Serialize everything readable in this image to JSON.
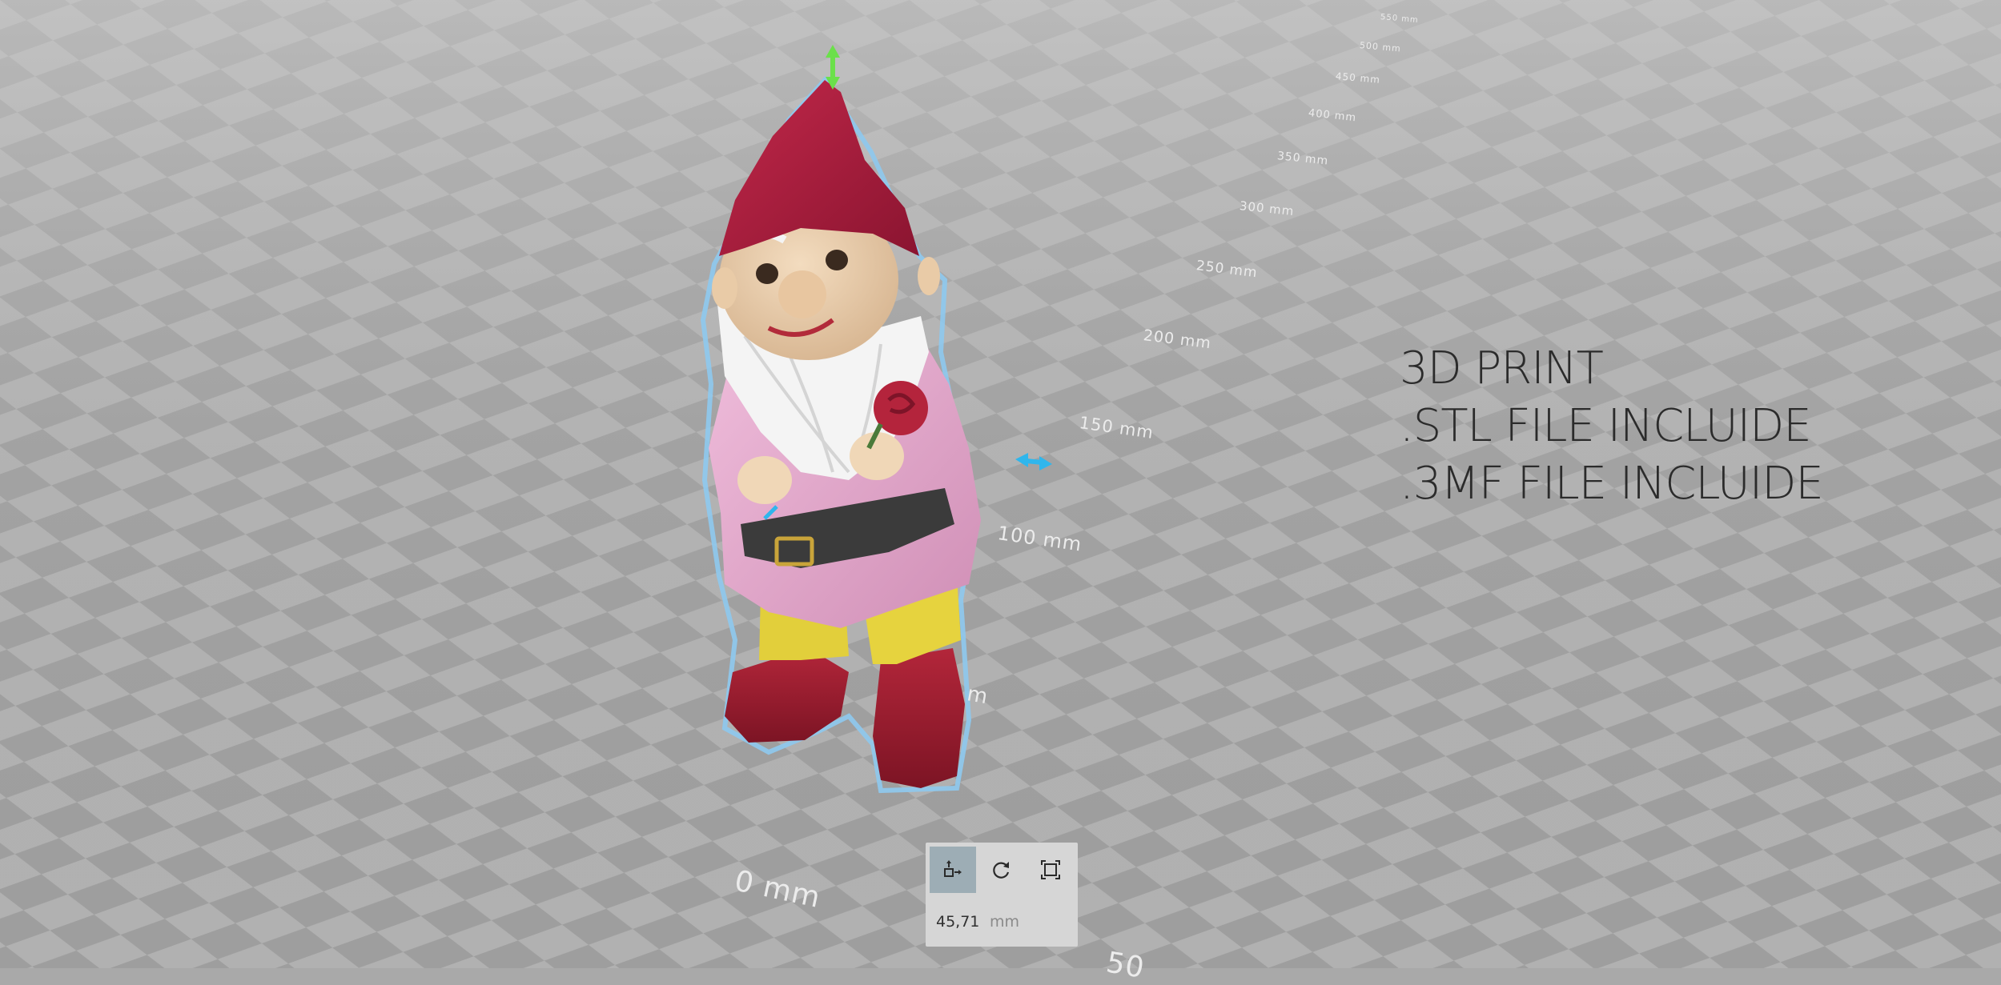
{
  "viewport": {
    "ruler_labels": [
      "0 mm",
      "50",
      "m",
      "100 mm",
      "150 mm",
      "200 mm",
      "250 mm",
      "300 mm",
      "350 mm",
      "400 mm",
      "450 mm",
      "500 mm",
      "550 mm"
    ]
  },
  "promo": {
    "line1": "3D PRINT",
    "line2": ".STL FILE INCLUIDE",
    "line3": ".3MF FILE INCLUIDE"
  },
  "toolbar": {
    "tools": [
      {
        "name": "move-tool",
        "icon": "move-icon",
        "active": true
      },
      {
        "name": "rotate-tool",
        "icon": "rotate-icon",
        "active": false
      },
      {
        "name": "scale-tool",
        "icon": "scale-icon",
        "active": false
      }
    ],
    "size_value": "45,71",
    "size_unit": "mm"
  },
  "colors": {
    "checker_light": "#b4b4b4",
    "checker_dark": "#9f9f9f",
    "selection_outline": "#8ec9ee",
    "move_y_arrow": "#6be04a",
    "move_x_arrow": "#2fb6ec",
    "active_tool": "#9dadb5",
    "toolbar_bg": "#d6d6d6"
  }
}
